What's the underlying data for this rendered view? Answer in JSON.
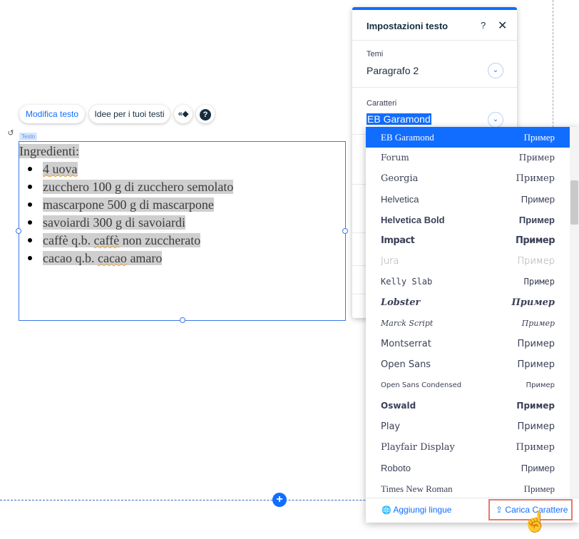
{
  "toolbar": {
    "edit_text": "Modifica testo",
    "text_ideas": "Idee per i tuoi testi",
    "animation_glyph": "«◆",
    "help_glyph": "?"
  },
  "element_tag": "Testo",
  "text_content": {
    "title": "Ingredienti:",
    "items": [
      {
        "a": "4",
        "b": " uova",
        "c": ""
      },
      {
        "a": "zucchero 100 g di zucchero semolato",
        "b": "",
        "c": ""
      },
      {
        "a": "mascarpone 500 g di mascarpone",
        "b": "",
        "c": ""
      },
      {
        "a": "savoiardi 300 g di savoiardi",
        "b": "",
        "c": ""
      },
      {
        "a": "caffè q.b. ",
        "b": "caffè",
        "c": " non zuccherato"
      },
      {
        "a": "cacao q.b. ",
        "b": "cacao",
        "c": " amaro"
      }
    ]
  },
  "panel": {
    "title": "Impostazioni testo",
    "help": "?",
    "close": "✕",
    "themes_label": "Temi",
    "themes_value": "Paragrafo 2",
    "fonts_label": "Caratteri",
    "fonts_value": "EB Garamond",
    "chevron": "⌄"
  },
  "font_dropdown": {
    "sample": "Пример",
    "fonts": [
      {
        "name": "EB Garamond",
        "cls": "f-eb",
        "active": true
      },
      {
        "name": "Forum",
        "cls": "f-forum"
      },
      {
        "name": "Georgia",
        "cls": "f-georgia"
      },
      {
        "name": "Helvetica",
        "cls": "f-helv"
      },
      {
        "name": "Helvetica Bold",
        "cls": "f-helvb"
      },
      {
        "name": "Impact",
        "cls": "f-impact"
      },
      {
        "name": "Jura",
        "cls": "f-jura"
      },
      {
        "name": "Kelly Slab",
        "cls": "f-kelly"
      },
      {
        "name": "Lobster",
        "cls": "f-lobster"
      },
      {
        "name": "Marck Script",
        "cls": "f-marck"
      },
      {
        "name": "Montserrat",
        "cls": "f-mont"
      },
      {
        "name": "Open Sans",
        "cls": "f-open"
      },
      {
        "name": "Open Sans Condensed",
        "cls": "f-osc"
      },
      {
        "name": "Oswald",
        "cls": "f-oswald"
      },
      {
        "name": "Play",
        "cls": "f-play"
      },
      {
        "name": "Playfair Display",
        "cls": "f-playfair"
      },
      {
        "name": "Roboto",
        "cls": "f-roboto"
      },
      {
        "name": "Times New Roman",
        "cls": "f-times"
      }
    ],
    "footer": {
      "add_languages": "Aggiungi lingue",
      "upload_font": "Carica Carattere"
    }
  },
  "icons": {
    "undo": "↺",
    "add": "+",
    "globe": "🌐",
    "upload": "⇪",
    "cursor": "☝"
  },
  "colors": {
    "accent": "#116dff",
    "highlight": "#cfcfcf",
    "upload_outline": "#e8786a"
  }
}
